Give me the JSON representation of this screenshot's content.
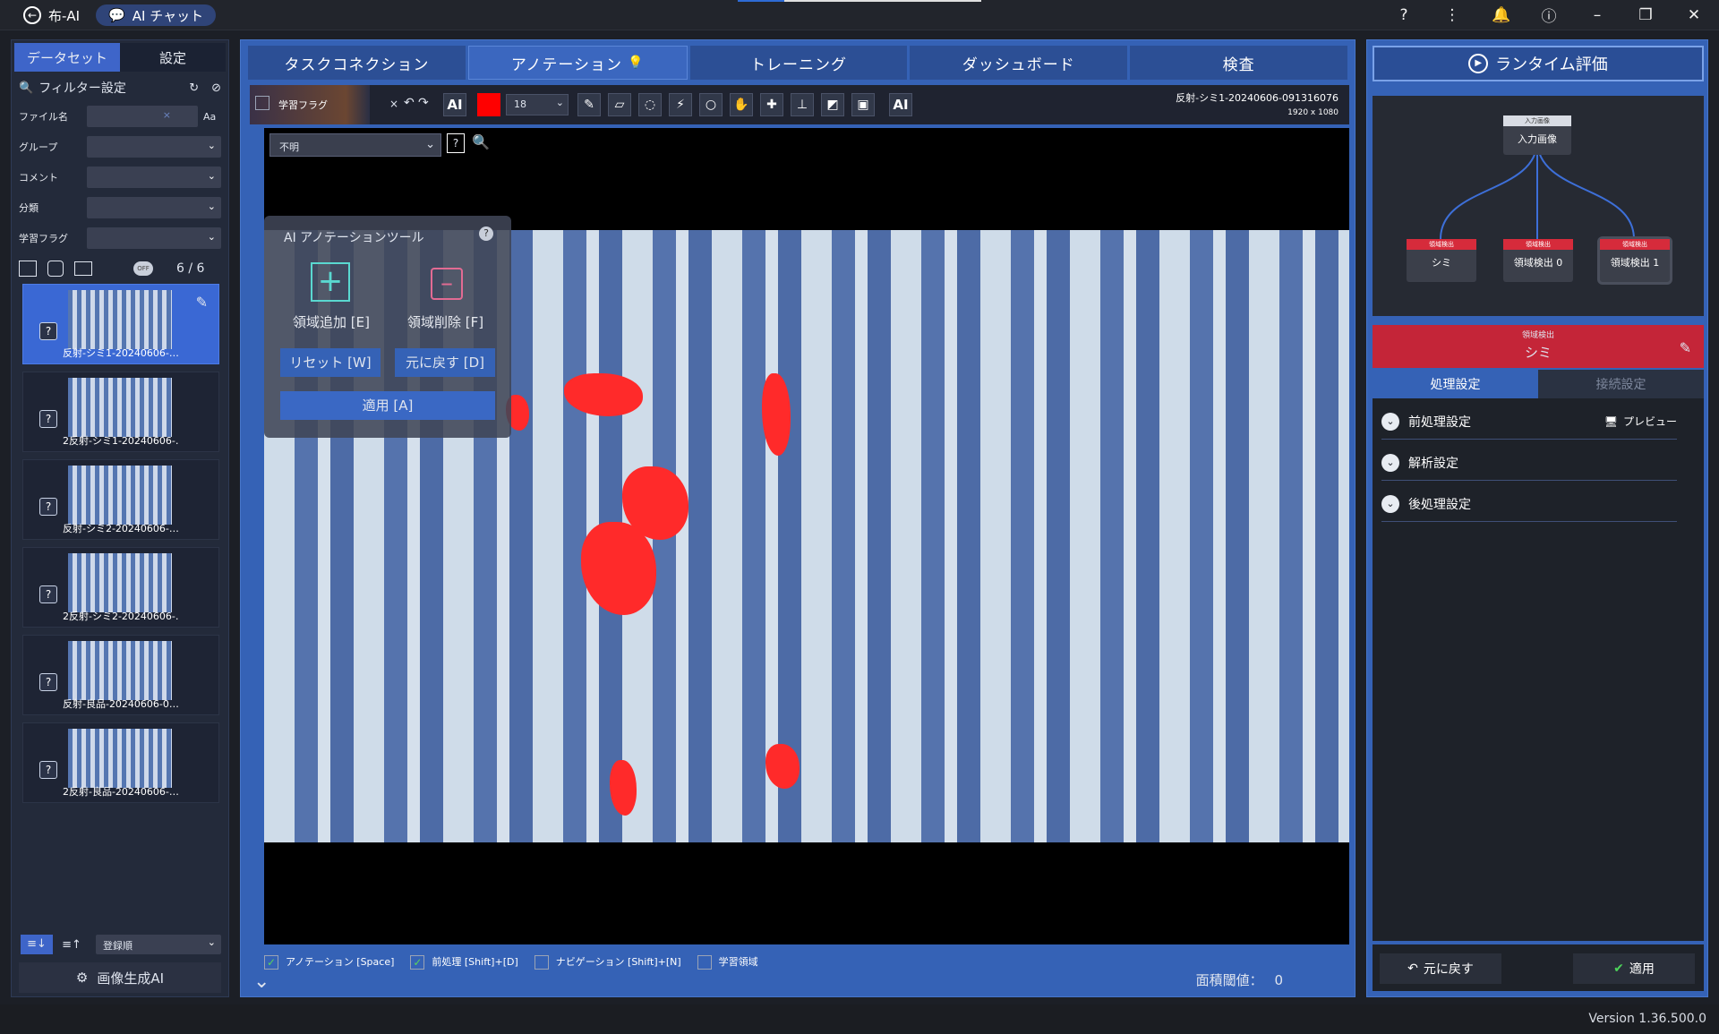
{
  "topbar": {
    "app": "布-AI",
    "chat": "AI チャット"
  },
  "left": {
    "tab_dataset": "データセット",
    "tab_settings": "設定",
    "filter_title": "フィルター設定",
    "labels": {
      "file": "ファイル名",
      "group": "グループ",
      "comment": "コメント",
      "class": "分類",
      "flag": "学習フラグ"
    },
    "case_btn": "Aa",
    "count": "6 / 6",
    "toggle": "OFF",
    "thumbs": [
      "反射-シミ1-20240606-…",
      "2反射-シミ1-20240606-…",
      "反射-シミ2-20240606-…",
      "2反射-シミ2-20240606-…",
      "反射-良品-20240606-0…",
      "2反射-良品-20240606-…"
    ],
    "sort": "登録順",
    "gen_ai": "画像生成AI"
  },
  "center": {
    "tabs": [
      "タスクコネクション",
      "アノテーション",
      "トレーニング",
      "ダッシュボード",
      "検査"
    ],
    "learn_flag": "学習フラグ",
    "ai_btn": "AI",
    "brush_size": "18",
    "ai_btn2": "AI",
    "filename": "反射-シミ1-20240606-091316076",
    "resolution": "1920 x 1080",
    "class_select": "不明",
    "ai_panel": {
      "title": "AI アノテーションツール",
      "add": "領域追加 [E]",
      "remove": "領域削除 [F]",
      "reset": "リセット [W]",
      "undo": "元に戻す [D]",
      "apply": "適用 [A]"
    },
    "bottom": {
      "annotation": "アノテーション [Space]",
      "preprocess": "前処理 [Shift]+[D]",
      "navigation": "ナビゲーション [Shift]+[N]",
      "learn_area": "学習領域",
      "area_threshold": "面積閾値：",
      "threshold_value": "0"
    }
  },
  "right": {
    "title": "ランタイム評価",
    "flow": {
      "input_head": "入力画像",
      "input": "入力画像",
      "n1_head": "領域検出",
      "n1": "シミ",
      "n2_head": "領域検出",
      "n2": "領域検出 0",
      "n3_head": "領域検出",
      "n3": "領域検出 1"
    },
    "node_type": "領域検出",
    "node_name": "シミ",
    "tab_process": "処理設定",
    "tab_connect": "接続設定",
    "pre": "前処理設定",
    "preview": "プレビュー",
    "analysis": "解析設定",
    "post": "後処理設定",
    "undo": "元に戻す",
    "apply": "適用"
  },
  "status": {
    "version": "Version 1.36.500.0"
  }
}
